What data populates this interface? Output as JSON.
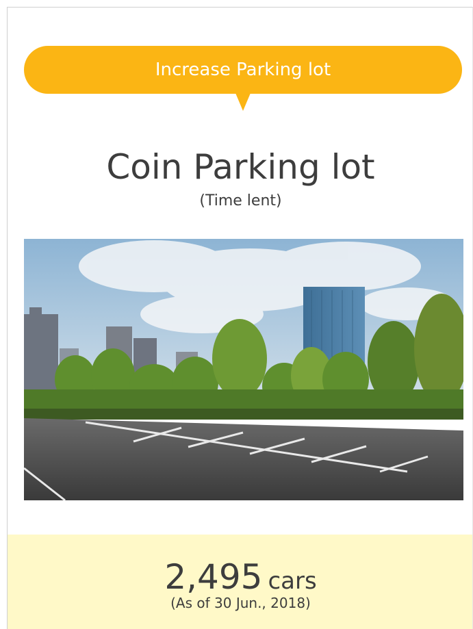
{
  "banner": {
    "label": "Increase Parking lot",
    "color": "#fbb514"
  },
  "heading": {
    "title": "Coin Parking lot",
    "subtitle": "(Time lent)"
  },
  "photo": {
    "subject": "parking-lot-photo"
  },
  "stats": {
    "count": "2,495",
    "unit": "cars",
    "as_of": "(As of 30 Jun., 2018)",
    "background": "#fff9c8"
  }
}
